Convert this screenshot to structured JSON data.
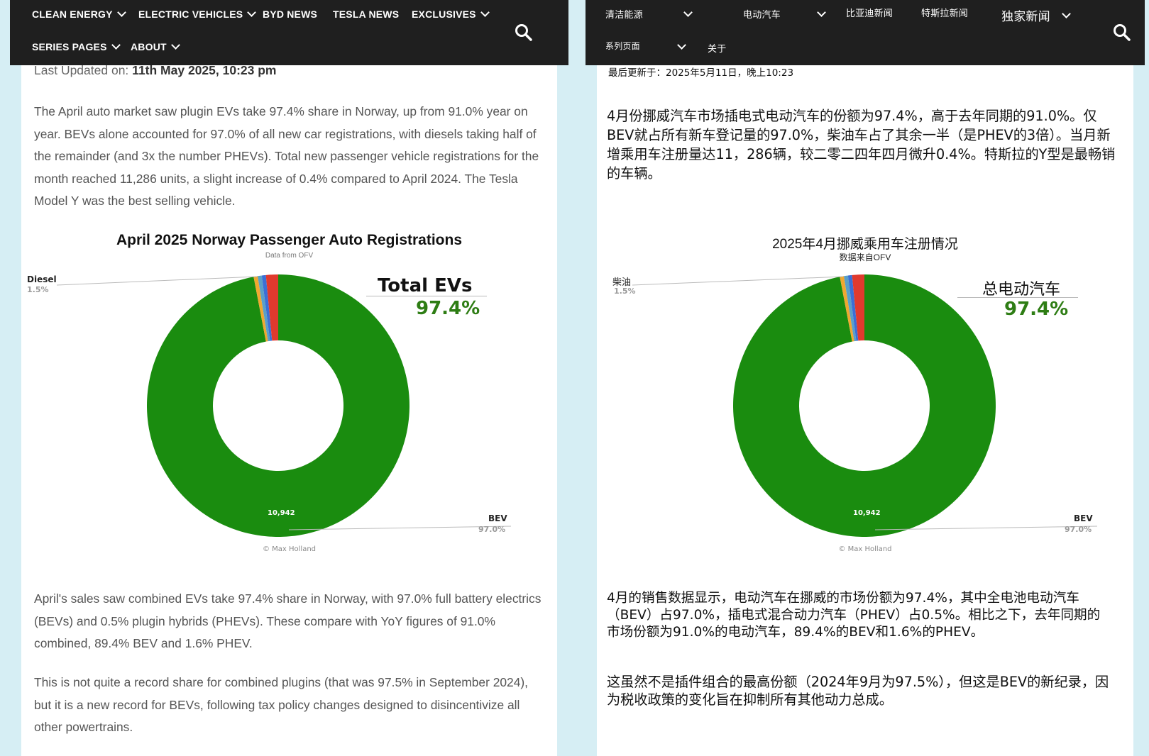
{
  "left": {
    "nav": {
      "row1": [
        "CLEAN ENERGY",
        "ELECTRIC VEHICLES",
        "BYD NEWS",
        "TESLA NEWS",
        "EXCLUSIVES"
      ],
      "row2": [
        "SERIES PAGES",
        "ABOUT"
      ]
    },
    "updated_label": "Last Updated on:",
    "updated_value": "11th May 2025, 10:23 pm",
    "para1": "The April auto market saw plugin EVs take 97.4% share in Norway, up from 91.0% year on year. BEVs alone accounted for 97.0% of all new car registrations, with diesels taking half of the remainder (and 3x the number PHEVs). Total new passenger vehicle registrations for the month reached 11,286 units, a slight increase of 0.4% compared to April 2024. The Tesla Model Y was the best selling vehicle.",
    "para2": "April's sales saw combined EVs take 97.4% share in Norway, with 97.0% full battery electrics (BEVs) and 0.5% plugin hybrids (PHEVs). These compare with YoY figures of 91.0% combined, 89.4% BEV and 1.6% PHEV.",
    "para3": "This is not quite a record share for combined plugins (that was 97.5% in September 2024), but it is a new record for BEVs, following tax policy changes designed to disincentivize all other powertrains.",
    "chart": {
      "title": "April 2025 Norway Passenger Auto Registrations",
      "subtitle": "Data from OFV",
      "total_label": "Total EVs",
      "total_value": "97.4%",
      "diesel_name": "Diesel",
      "diesel_pct": "1.5%",
      "bev_name": "BEV",
      "bev_pct": "97.0%",
      "center_value": "10,942",
      "credit": "© Max Holland"
    }
  },
  "right": {
    "nav": {
      "row1": [
        "清洁能源",
        "电动汽车",
        "比亚迪新闻",
        "特斯拉新闻",
        "独家新闻"
      ],
      "row2": [
        "系列页面",
        "关于"
      ]
    },
    "updated": "最后更新于：2025年5月11日，晚上10:23",
    "para1": "4月份挪威汽车市场插电式电动汽车的份额为97.4%，高于去年同期的91.0%。仅BEV就占所有新车登记量的97.0%，柴油车占了其余一半（是PHEV的3倍）。当月新增乘用车注册量达11，286辆，较二零二四年四月微升0.4%。特斯拉的Y型是最畅销的车辆。",
    "para2": "4月的销售数据显示，电动汽车在挪威的市场份额为97.4%，其中全电池电动汽车（BEV）占97.0%，插电式混合动力汽车（PHEV）占0.5%。相比之下，去年同期的市场份额为91.0%的电动汽车，89.4%的BEV和1.6%的PHEV。",
    "para3": "这虽然不是插件组合的最高份额（2024年9月为97.5%），但这是BEV的新纪录，因为税收政策的变化旨在抑制所有其他动力总成。",
    "chart": {
      "title": "2025年4月挪威乘用车注册情况",
      "subtitle": "数据来自OFV",
      "total_label": "总电动汽车",
      "total_value": "97.4%",
      "diesel_name": "柴油",
      "diesel_pct": "1.5%",
      "bev_name": "BEV",
      "bev_pct": "97.0%",
      "center_value": "10,942",
      "credit": "© Max Holland"
    }
  },
  "chart_data": {
    "type": "pie",
    "title": "April 2025 Norway Passenger Auto Registrations",
    "subtitle": "Data from OFV",
    "slices": [
      {
        "name": "BEV",
        "percent": 97.0,
        "value": 10942,
        "color": "#1a8c0f"
      },
      {
        "name": "Diesel",
        "percent": 1.5,
        "color": "#e03a2e"
      },
      {
        "color": "#3b6fd6"
      },
      {
        "color": "#5aa0c8"
      },
      {
        "color": "#f0a830"
      }
    ],
    "annotation": {
      "label": "Total EVs",
      "value": "97.4%"
    }
  },
  "colors": {
    "navbar": "#1f1f1f",
    "bev": "#1a8c0f",
    "accent_green": "#2e7d14"
  }
}
